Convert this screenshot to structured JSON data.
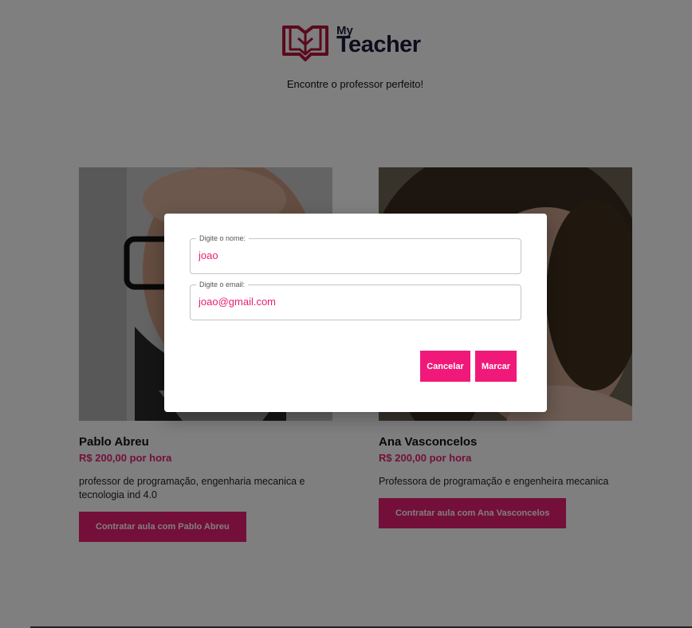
{
  "header": {
    "logo_my": "My",
    "logo_teacher": "Teacher",
    "tagline": "Encontre o professor perfeito!"
  },
  "colors": {
    "accent": "#e91e74",
    "brand_dark": "#1b1b3a",
    "logo_red": "#b5173d"
  },
  "teachers": [
    {
      "name": "Pablo Abreu",
      "price": "R$ 200,00 por hora",
      "description": "professor de programação, engenharia mecanica e tecnologia ind 4.0",
      "button_label": "Contratar aula com Pablo Abreu"
    },
    {
      "name": "Ana Vasconcelos",
      "price": "R$ 200,00 por hora",
      "description": "Professora de programação e engenheira mecanica",
      "button_label": "Contratar aula com Ana Vasconcelos"
    }
  ],
  "dialog": {
    "name_label": "Digite o nome:",
    "name_value": "joao",
    "email_label": "Digite o email:",
    "email_value": "joao@gmail.com",
    "cancel_label": "Cancelar",
    "confirm_label": "Marcar"
  }
}
